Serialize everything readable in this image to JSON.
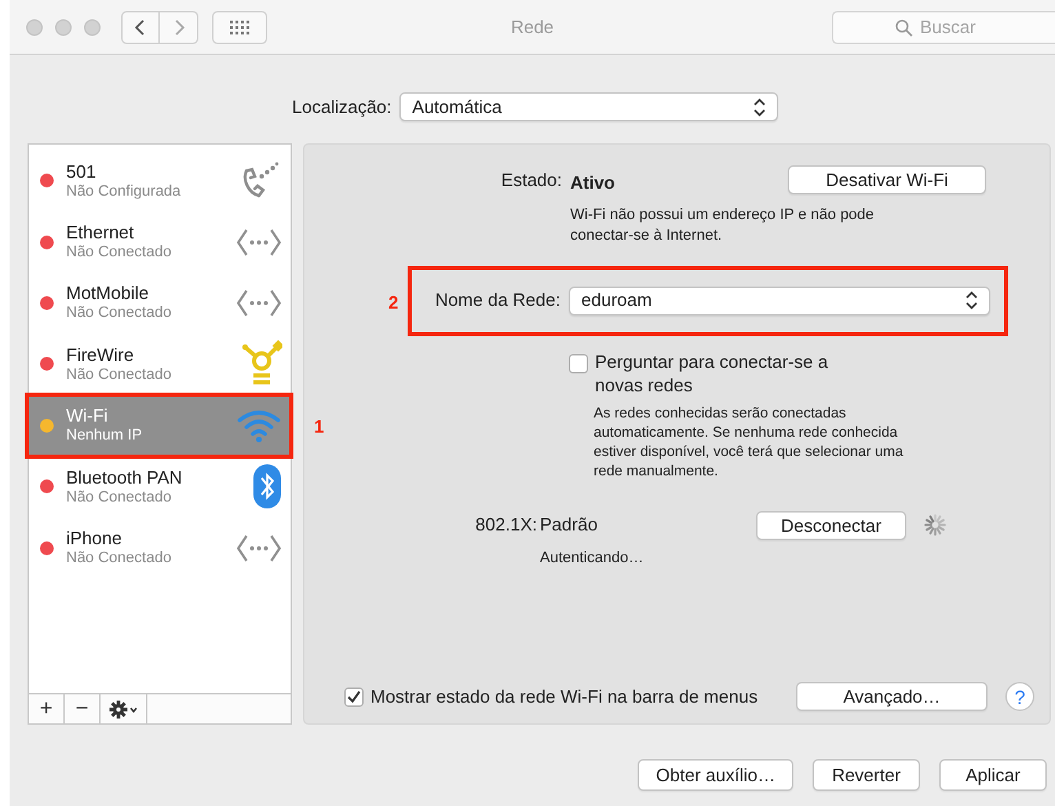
{
  "window": {
    "title": "Rede",
    "search": {
      "placeholder": "Buscar"
    }
  },
  "location": {
    "label": "Localização:",
    "value": "Automática"
  },
  "services": [
    {
      "name": "501",
      "status": "Não Configurada",
      "kind": "phone",
      "color": "#ef4a4f",
      "selected": false
    },
    {
      "name": "Ethernet",
      "status": "Não Conectado",
      "kind": "ethernet",
      "color": "#ef4a4f",
      "selected": false
    },
    {
      "name": "MotMobile",
      "status": "Não Conectado",
      "kind": "ethernet",
      "color": "#ef4a4f",
      "selected": false
    },
    {
      "name": "FireWire",
      "status": "Não Conectado",
      "kind": "firewire",
      "color": "#ef4a4f",
      "selected": false
    },
    {
      "name": "Wi-Fi",
      "status": "Nenhum IP",
      "kind": "wifi",
      "color": "#f5b72e",
      "selected": true,
      "callout": "1"
    },
    {
      "name": "Bluetooth PAN",
      "status": "Não Conectado",
      "kind": "bluetooth",
      "color": "#ef4a4f",
      "selected": false
    },
    {
      "name": "iPhone",
      "status": "Não Conectado",
      "kind": "ethernet",
      "color": "#ef4a4f",
      "selected": false
    }
  ],
  "sidebar_toolbar": {
    "add": "+",
    "remove": "−"
  },
  "detail": {
    "status_label": "Estado:",
    "status_value": "Ativo",
    "toggle_button": "Desativar Wi-Fi",
    "status_note": "Wi-Fi não possui um endereço IP e não pode conectar-se à Internet.",
    "network": {
      "label": "Nome da Rede:",
      "value": "eduroam",
      "callout": "2"
    },
    "ask_to_join": {
      "label": "Perguntar para conectar-se a novas redes",
      "checked": false
    },
    "ask_note": "As redes conhecidas serão conectadas automaticamente. Se nenhuma rede conhecida estiver disponível, você terá que selecionar uma rede manualmente.",
    "security": {
      "label": "802.1X:",
      "value": "Padrão",
      "button": "Desconectar",
      "state": "Autenticando…"
    },
    "show_in_menu": {
      "label": "Mostrar estado da rede Wi-Fi na barra de menus",
      "checked": true
    },
    "advanced_button": "Avançado…",
    "help": "?"
  },
  "footer_buttons": [
    "Obter auxílio…",
    "Reverter",
    "Aplicar"
  ]
}
